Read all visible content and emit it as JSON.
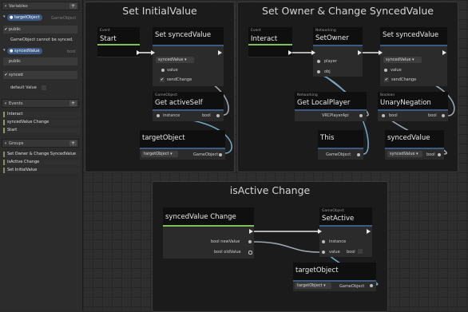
{
  "sidebar": {
    "variables_header": "Variables",
    "var1": {
      "name": "targetObject",
      "type": "GameObject",
      "public_label": "public",
      "warning": "GameObject cannot be synced."
    },
    "var2": {
      "name": "syncedValue",
      "type": "bool",
      "public_label": "public",
      "synced_label": "synced",
      "default_label": "default Value"
    },
    "events_header": "Events",
    "events": [
      "Interact",
      "syncedValue Change",
      "Start"
    ],
    "groups_header": "Groups",
    "groups": [
      "Set Owner & Change SyncedValue",
      "isActive Change",
      "Set InitialValue"
    ]
  },
  "graph": {
    "groups": {
      "g1": "Set InitialValue",
      "g2": "Set Owner & Change SyncedValue",
      "g3": "isActive Change"
    },
    "nodes": {
      "start": {
        "cat": "Event",
        "name": "Start"
      },
      "setsv1": {
        "name": "Set syncedValue",
        "dd": "syncedValue ▾",
        "value": "value",
        "send": "sendChange"
      },
      "getactive": {
        "cat": "GameObject",
        "name": "Get activeSelf",
        "instance": "instance",
        "bool": "bool"
      },
      "target1": {
        "name": "targetObject",
        "dd": "targetObject ▾",
        "type": "GameObject"
      },
      "interact": {
        "cat": "Event",
        "name": "Interact"
      },
      "setowner": {
        "cat": "Networking",
        "name": "SetOwner",
        "player": "player",
        "obj": "obj"
      },
      "setsv2": {
        "name": "Set syncedValue",
        "dd": "syncedValue ▾",
        "value": "value",
        "send": "sendChange"
      },
      "getlocal": {
        "cat": "Networking",
        "name": "Get LocalPlayer",
        "type": "VRCPlayerApi"
      },
      "unary": {
        "cat": "Boolean",
        "name": "UnaryNegation",
        "bool_in": "bool",
        "bool_out": "bool"
      },
      "this": {
        "name": "This",
        "type": "GameObject"
      },
      "sv": {
        "name": "syncedValue",
        "dd": "syncedValue ▾",
        "type": "bool"
      },
      "svchange": {
        "name": "syncedValue Change",
        "newv": "bool newValue",
        "oldv": "bool oldValue"
      },
      "setactive": {
        "cat": "GameObject",
        "name": "SetActive",
        "instance": "instance",
        "value": "value",
        "bool": "bool"
      },
      "target2": {
        "name": "targetObject",
        "dd": "targetObject ▾",
        "type": "GameObject"
      }
    }
  },
  "colors": {
    "flow": "#e8e8e8",
    "event_bar": "#7fbf5a",
    "group_bg": "#1b1b1b",
    "pill": "#3c5a86"
  }
}
